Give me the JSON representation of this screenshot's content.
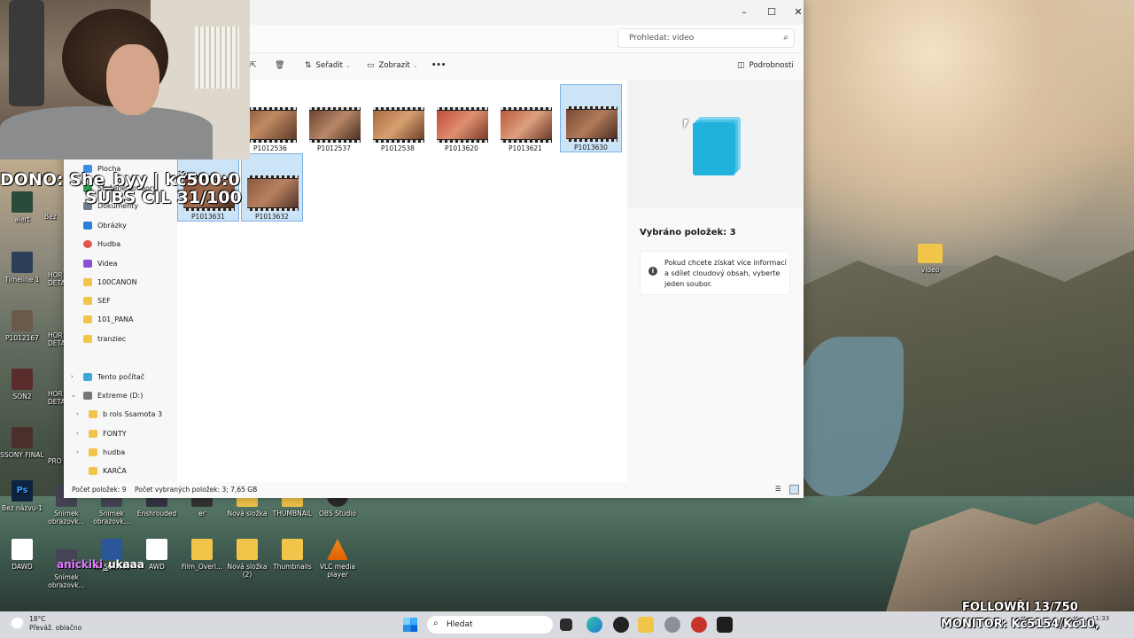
{
  "explorer": {
    "search_placeholder": "Prohledat: video",
    "toolbar": {
      "sort_label": "Seřadit",
      "view_label": "Zobrazit",
      "more_label": "•••",
      "details_label": "Podrobnosti"
    },
    "nav": {
      "quick": [
        {
          "label": "Plocha",
          "pinned": true
        },
        {
          "label": "Stažené soubory",
          "pinned": true
        },
        {
          "label": "Dokumenty",
          "pinned": true
        },
        {
          "label": "Obrázky",
          "pinned": true
        },
        {
          "label": "Hudba",
          "pinned": true
        },
        {
          "label": "Videa",
          "pinned": true
        },
        {
          "label": "100CANON",
          "pinned": false
        },
        {
          "label": "SEF",
          "pinned": false
        },
        {
          "label": "101_PANA",
          "pinned": false
        },
        {
          "label": "tranziec",
          "pinned": false
        }
      ],
      "this_pc": "Tento počítač",
      "drive": "Extreme (D:)",
      "drive_children": [
        "b rols Ssamota 3",
        "FONTY",
        "hudba",
        "KARČA"
      ]
    },
    "files": [
      {
        "name": "P1012536",
        "selected": false
      },
      {
        "name": "P1012537",
        "selected": false
      },
      {
        "name": "P1012538",
        "selected": false
      },
      {
        "name": "P1013620",
        "selected": false
      },
      {
        "name": "P1013621",
        "selected": false
      },
      {
        "name": "P1013630",
        "selected": true
      },
      {
        "name": "P1013631",
        "selected": true
      },
      {
        "name": "P1013632",
        "selected": true
      }
    ],
    "details": {
      "selected_count": "Vybráno položek: 3",
      "info": "Pokud chcete získat více informací a sdílet cloudový obsah, vyberte jeden soubor."
    },
    "status": {
      "items": "Počet položek: 9",
      "selected": "Počet vybraných položek: 3; 7,65 GB"
    }
  },
  "overlays": {
    "dono": "DONO: She_byy | kč500:0",
    "subs": "SUBS CIL 31/100",
    "chat_user": "anickiki",
    "chat_text": "_ukaaa",
    "followers": "FOLLOWŘI 13/750",
    "monitor": "MONITOR: Kč5154/Kč10,"
  },
  "desktop": {
    "icons": [
      {
        "label": "alert"
      },
      {
        "label": "Timeline 1"
      },
      {
        "label": "P1012167"
      },
      {
        "label": "SON2"
      },
      {
        "label": "SSONY FINAL"
      },
      {
        "label": "Bez názvu-1"
      },
      {
        "label": "Snímek obrazovk..."
      },
      {
        "label": "Snímek obrazovk..."
      },
      {
        "label": "Enshrouded"
      },
      {
        "label": "er"
      },
      {
        "label": "Nová složka"
      },
      {
        "label": "THUMBNAIL"
      },
      {
        "label": "OBS Studio"
      },
      {
        "label": "DAWD"
      },
      {
        "label": "Snímek obrazovk..."
      },
      {
        "label": "MASCOTTE"
      },
      {
        "label": "AWD"
      },
      {
        "label": "Film_Overl..."
      },
      {
        "label": "Nová složka (2)"
      },
      {
        "label": "Thumbnails"
      },
      {
        "label": "VLC media player"
      },
      {
        "label": "video"
      }
    ],
    "partial_labels": [
      "Bez",
      "HOR DETA",
      "HOR DETA",
      "HOR DETA",
      "PRO"
    ]
  },
  "taskbar": {
    "temperature": "18°C",
    "weather": "Převáž. oblačno",
    "search_label": "Hledat",
    "clock": "11:33"
  },
  "colors": {
    "selection": "#cce4f7",
    "selection_border": "#7fb1e2",
    "folder": "#f1c44a",
    "chat_name": "#e079ff"
  }
}
